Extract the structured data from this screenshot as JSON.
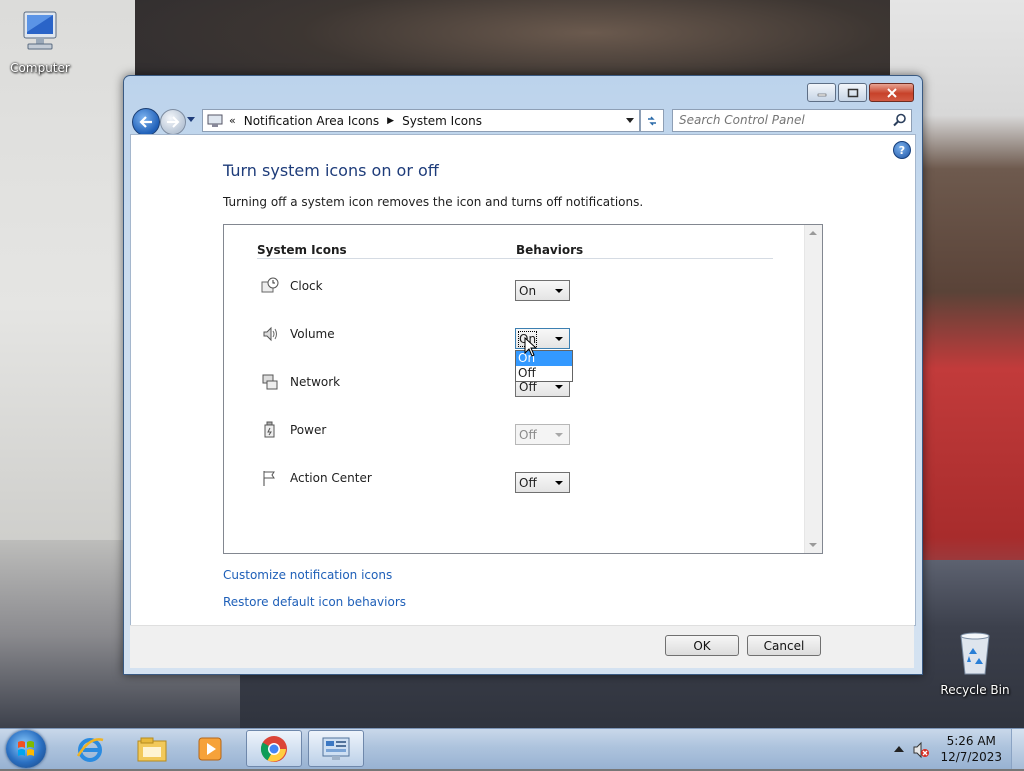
{
  "desktop": {
    "icons": [
      {
        "label": "Computer",
        "icon": "computer-icon"
      },
      {
        "label": "Recycle Bin",
        "icon": "recycle-bin-icon"
      }
    ]
  },
  "window": {
    "nav": {
      "breadcrumb": [
        "Notification Area Icons",
        "System Icons"
      ],
      "search_placeholder": "Search Control Panel"
    },
    "help_glyph": "?",
    "title": "Turn system icons on or off",
    "description": "Turning off a system icon removes the icon and turns off notifications.",
    "table": {
      "headers": {
        "icons": "System Icons",
        "behaviors": "Behaviors"
      },
      "rows": [
        {
          "name": "Clock",
          "icon": "clock-icon",
          "value": "On",
          "enabled": true
        },
        {
          "name": "Volume",
          "icon": "volume-icon",
          "value": "On",
          "enabled": true,
          "open": true
        },
        {
          "name": "Network",
          "icon": "network-icon",
          "value": "Off",
          "enabled": true
        },
        {
          "name": "Power",
          "icon": "power-icon",
          "value": "Off",
          "enabled": false
        },
        {
          "name": "Action Center",
          "icon": "action-center-flag-icon",
          "value": "Off",
          "enabled": true
        }
      ],
      "dropdown_options": [
        "On",
        "Off"
      ],
      "dropdown_selected": "On"
    },
    "links": {
      "customize": "Customize notification icons",
      "restore": "Restore default icon behaviors"
    },
    "buttons": {
      "ok": "OK",
      "cancel": "Cancel"
    }
  },
  "taskbar": {
    "pinned": [
      "internet-explorer-icon",
      "windows-explorer-icon",
      "media-player-icon",
      "chrome-icon",
      "control-panel-icon"
    ],
    "clock": {
      "time": "5:26 AM",
      "date": "12/7/2023"
    }
  },
  "colors": {
    "title_blue": "#1e3c7a",
    "link_blue": "#1e5fb8",
    "selection_blue": "#3399ff"
  }
}
